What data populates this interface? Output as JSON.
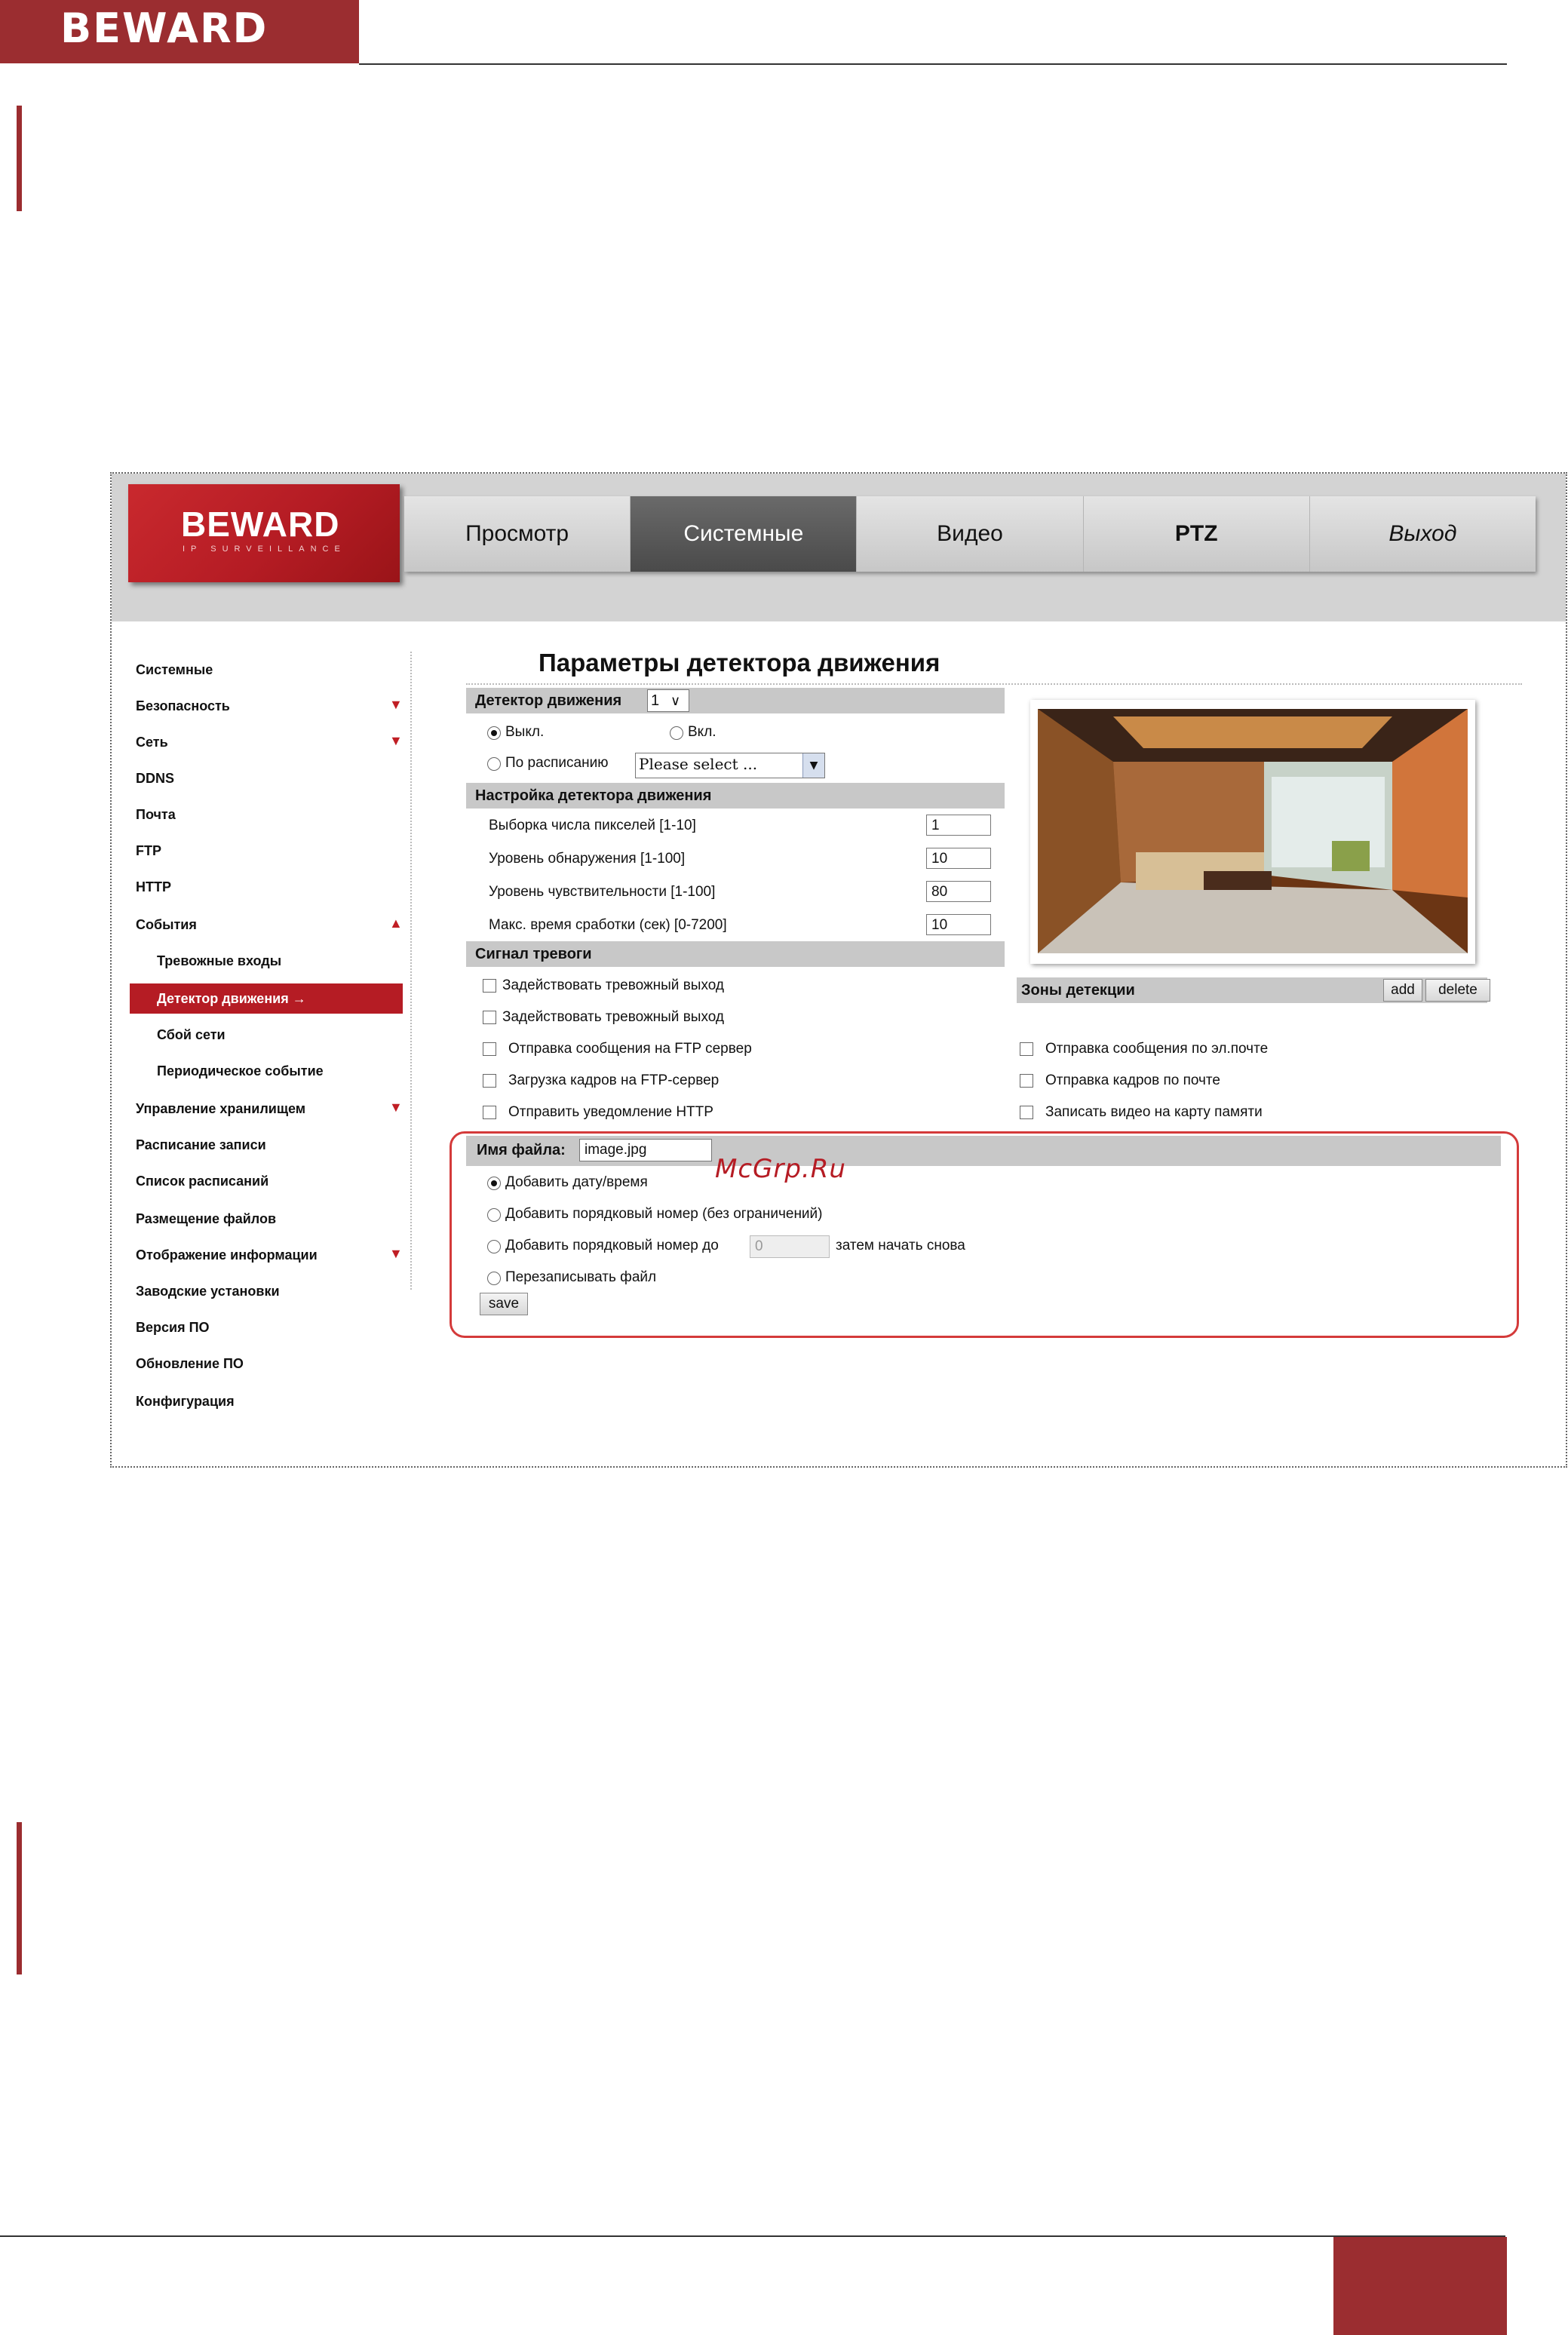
{
  "document": {
    "logo": "BEWARD",
    "colors": {
      "brand": "#9b2d30",
      "active_tab": "#4f4f4f",
      "sidebar_active": "#b51c24",
      "highlight_frame": "#d43a3a"
    }
  },
  "app": {
    "logo": "BEWARD",
    "logo_sub": "IP SURVEILLANCE",
    "tabs": [
      {
        "label": "Просмотр",
        "active": false
      },
      {
        "label": "Системные",
        "active": true
      },
      {
        "label": "Видео",
        "active": false
      },
      {
        "label": "PTZ",
        "active": false
      },
      {
        "label": "Выход",
        "active": false
      }
    ]
  },
  "sidebar": {
    "items": [
      {
        "label": "Системные"
      },
      {
        "label": "Безопасность",
        "arrow": "▼"
      },
      {
        "label": "Сеть",
        "arrow": "▼"
      },
      {
        "label": "DDNS"
      },
      {
        "label": "Почта"
      },
      {
        "label": "FTP"
      },
      {
        "label": "HTTP"
      },
      {
        "label": "События",
        "arrow": "▲"
      },
      {
        "label": "Тревожные входы"
      },
      {
        "label": "Детектор движения →"
      },
      {
        "label": "Сбой сети"
      },
      {
        "label": "Периодическое событие"
      },
      {
        "label": "Управление хранилищем",
        "arrow": "▼"
      },
      {
        "label": "Расписание записи"
      },
      {
        "label": "Список расписаний"
      },
      {
        "label": "Размещение файлов"
      },
      {
        "label": "Отображение информации",
        "arrow": "▼"
      },
      {
        "label": "Заводские установки"
      },
      {
        "label": "Версия ПО"
      },
      {
        "label": "Обновление ПО"
      },
      {
        "label": "Конфигурация"
      }
    ]
  },
  "main": {
    "title": "Параметры детектора движения",
    "detector": {
      "label": "Детектор движения",
      "value": "1",
      "off_label": "Выкл.",
      "on_label": "Вкл.",
      "schedule_label": "По расписанию",
      "schedule_placeholder": "Please select ..."
    },
    "settings": {
      "header": "Настройка детектора движения",
      "rows": [
        {
          "label": "Выборка числа пикселей [1-10]",
          "value": "1"
        },
        {
          "label": "Уровень обнаружения [1-100]",
          "value": "10"
        },
        {
          "label": "Уровень чувствительности [1-100]",
          "value": "80"
        },
        {
          "label": "Макс. время сработки (сек) [0-7200]",
          "value": "10"
        }
      ]
    },
    "alarm": {
      "header": "Сигнал тревоги",
      "left": [
        "Задействовать тревожный выход",
        "Задействовать тревожный выход",
        "Отправка сообщения на FTP сервер",
        "Загрузка кадров на FTP-сервер",
        "Отправить уведомление HTTP"
      ],
      "right": [
        "Отправка сообщения по эл.почте",
        "Отправка кадров по почте",
        "Записать видео на карту памяти"
      ]
    },
    "zones": {
      "label": "Зоны детекции",
      "add": "add",
      "delete": "delete"
    },
    "file": {
      "label": "Имя файла:",
      "value": "image.jpg",
      "opt1": "Добавить дату/время",
      "opt2": "Добавить порядковый номер (без ограничений)",
      "opt3": "Добавить порядковый номер до",
      "opt3_value": "0",
      "opt3_suffix": "затем начать снова",
      "opt4": "Перезаписывать файл",
      "save": "save"
    },
    "watermark": "McGrp.Ru"
  }
}
